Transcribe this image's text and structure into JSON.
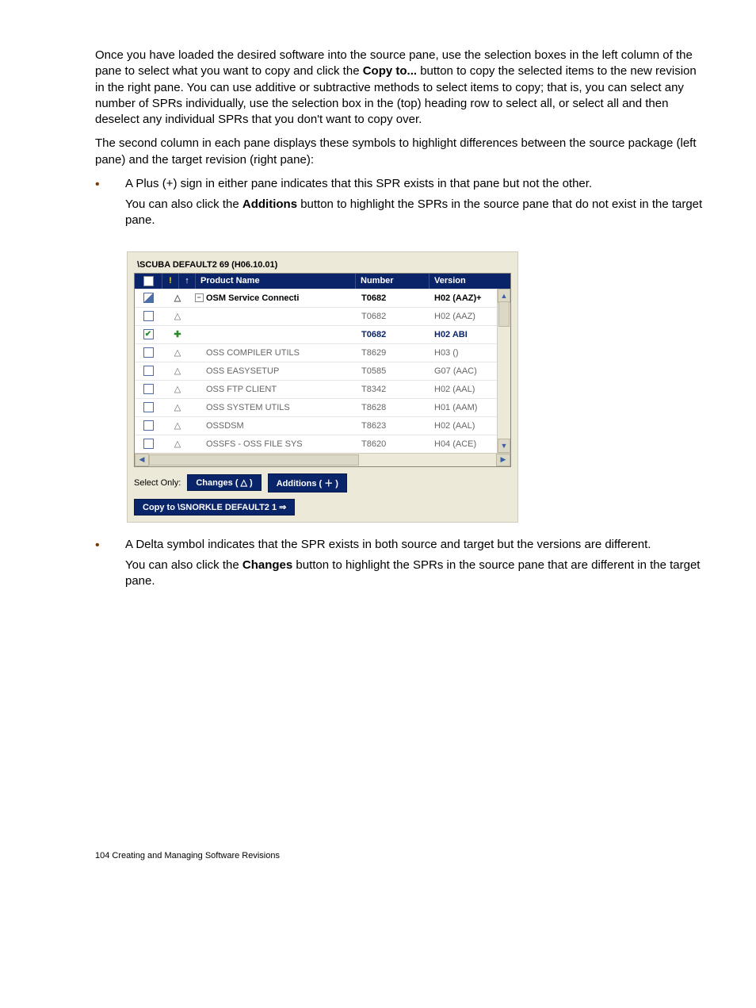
{
  "para1_a": "Once you have loaded the desired software into the source pane, use the selection boxes in the left column of the pane to select what you want to copy and click the ",
  "para1_bold": "Copy to...",
  "para1_b": " button to copy the selected items to the new revision in the right pane. You can use additive or subtractive methods to select items to copy; that is, you can select any number of SPRs individually, use the selection box in the (top) heading row to select all, or select all and then deselect any individual SPRs that you don't want to copy over.",
  "para2": "The second column in each pane displays these symbols to highlight differences between the source package (left pane) and the target revision (right pane):",
  "bullet1_line1": "A Plus (+) sign in either pane indicates that this SPR exists in that pane but not the other.",
  "bullet1_line2_a": "You can also click the ",
  "bullet1_line2_bold": "Additions",
  "bullet1_line2_b": " button to highlight the SPRs in the source pane that do not exist in the target pane.",
  "bullet2_line1": "A Delta symbol indicates that the SPR exists in both source and target but the versions are different.",
  "bullet2_line2_a": "You can also click the ",
  "bullet2_line2_bold": "Changes",
  "bullet2_line2_b": " button to highlight the SPRs in the source pane that are different in the target pane.",
  "shot": {
    "title": "\\SCUBA DEFAULT2 69 (H06.10.01)",
    "head": {
      "exc": "!",
      "arrow": "↑",
      "name": "Product Name",
      "number": "Number",
      "version": "Version"
    },
    "rows": [
      {
        "chk": "tri",
        "sym": "△",
        "exp": "−",
        "name": "OSM Service Connecti",
        "num": "T0682",
        "ver": "H02 (AAZ)+",
        "cls": "group"
      },
      {
        "chk": "empty",
        "sym": "△",
        "exp": "",
        "name": "",
        "num": "T0682",
        "ver": "H02 (AAZ)",
        "cls": "indent"
      },
      {
        "chk": "check",
        "sym": "✚",
        "exp": "",
        "name": "",
        "num": "T0682",
        "ver": "H02 ABI",
        "cls": "blue indent"
      },
      {
        "chk": "empty",
        "sym": "△",
        "exp": "",
        "name": "OSS COMPILER UTILS",
        "num": "T8629",
        "ver": "H03 ()",
        "cls": ""
      },
      {
        "chk": "empty",
        "sym": "△",
        "exp": "",
        "name": "OSS EASYSETUP",
        "num": "T0585",
        "ver": "G07 (AAC)",
        "cls": ""
      },
      {
        "chk": "empty",
        "sym": "△",
        "exp": "",
        "name": "OSS FTP CLIENT",
        "num": "T8342",
        "ver": "H02 (AAL)",
        "cls": ""
      },
      {
        "chk": "empty",
        "sym": "△",
        "exp": "",
        "name": "OSS SYSTEM UTILS",
        "num": "T8628",
        "ver": "H01 (AAM)",
        "cls": ""
      },
      {
        "chk": "empty",
        "sym": "△",
        "exp": "",
        "name": "OSSDSM",
        "num": "T8623",
        "ver": "H02 (AAL)",
        "cls": ""
      },
      {
        "chk": "empty",
        "sym": "△",
        "exp": "",
        "name": "OSSFS - OSS FILE SYS",
        "num": "T8620",
        "ver": "H04 (ACE)",
        "cls": ""
      }
    ],
    "select_only": "Select Only:",
    "changes_btn": "Changes ( △ )",
    "additions_btn": "Additions ( ＋ )",
    "copyto_btn": "Copy to \\SNORKLE DEFAULT2 1  ⇒"
  },
  "footer": "104   Creating and Managing Software Revisions"
}
